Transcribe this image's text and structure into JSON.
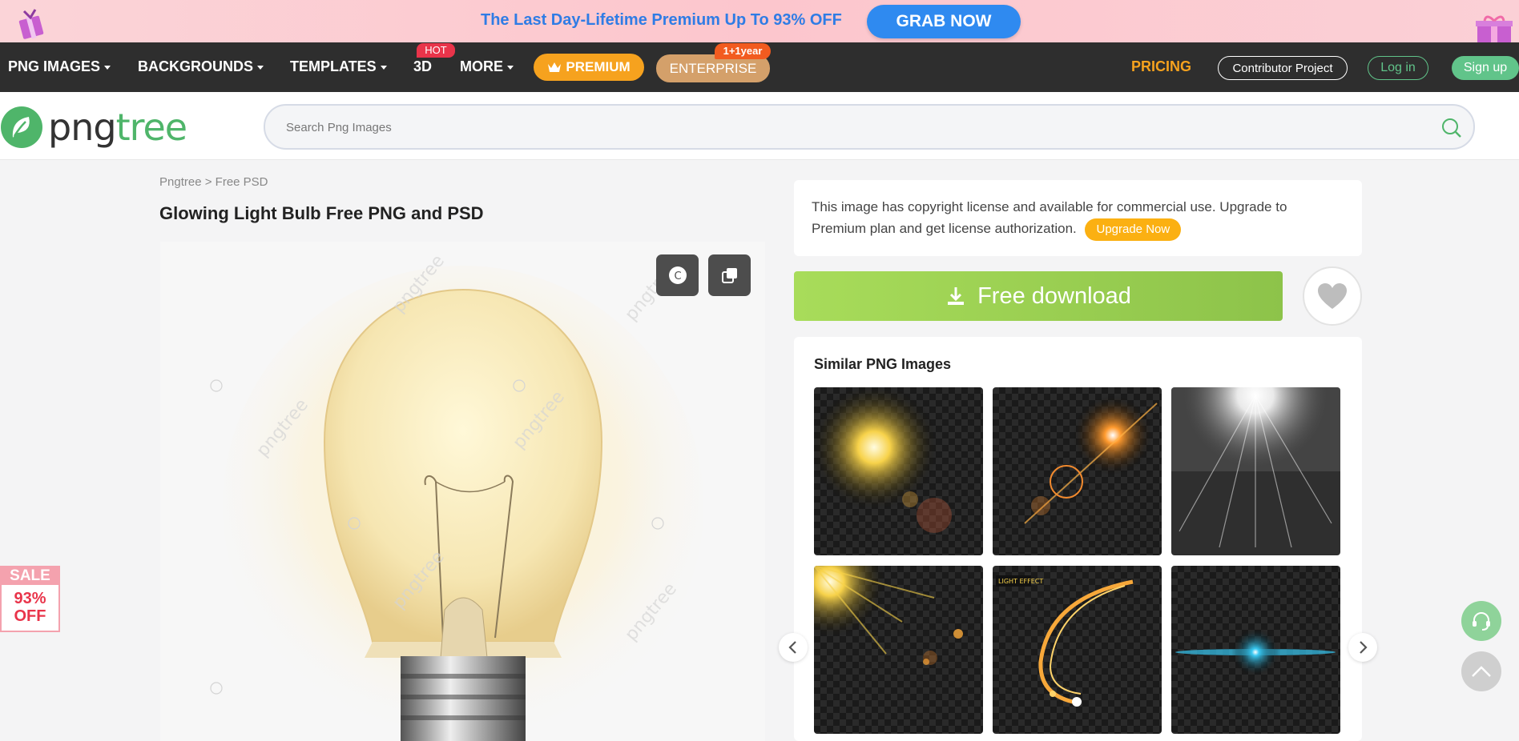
{
  "promo": {
    "text": "The Last Day-Lifetime Premium Up To 93% OFF",
    "button": "GRAB NOW"
  },
  "nav": {
    "items": [
      {
        "label": "PNG IMAGES",
        "dropdown": true
      },
      {
        "label": "BACKGROUNDS",
        "dropdown": true
      },
      {
        "label": "TEMPLATES",
        "dropdown": true
      },
      {
        "label": "3D",
        "dropdown": false
      },
      {
        "label": "MORE",
        "dropdown": true
      }
    ],
    "hot_badge": "HOT",
    "premium": "PREMIUM",
    "enterprise": "ENTERPRISE",
    "enterprise_badge": "1+1year",
    "pricing": "PRICING",
    "contributor": "Contributor Project",
    "login": "Log in",
    "signup": "Sign up"
  },
  "header": {
    "logo_part1": "png",
    "logo_part2": "tree",
    "search_placeholder": "Search Png Images"
  },
  "breadcrumb": {
    "root": "Pngtree",
    "separator": ">",
    "current": "Free PSD"
  },
  "page_title": "Glowing Light Bulb Free PNG and PSD",
  "preview": {
    "watermark": "pngtree",
    "copyright_btn": "C"
  },
  "sale": {
    "label": "SALE",
    "percent": "93%",
    "off": "OFF"
  },
  "license": {
    "text": "This image has copyright license and available for commercial use. Upgrade to Premium plan and get license authorization.",
    "upgrade_button": "Upgrade Now"
  },
  "download": {
    "label": "Free download"
  },
  "similar": {
    "title": "Similar PNG Images",
    "items": [
      {
        "name": "golden-glow"
      },
      {
        "name": "lens-flare"
      },
      {
        "name": "white-light-rays"
      },
      {
        "name": "sun-rays-sparkles"
      },
      {
        "name": "light-effect-swirl",
        "caption": "LIGHT EFFECT"
      },
      {
        "name": "blue-lens-flare"
      }
    ]
  },
  "colors": {
    "nav_bg": "#2e2e2e",
    "accent_orange": "#f6a21e",
    "accent_green": "#61c48a",
    "download_green": "#9ccf52",
    "promo_blue": "#2f7ce5"
  }
}
